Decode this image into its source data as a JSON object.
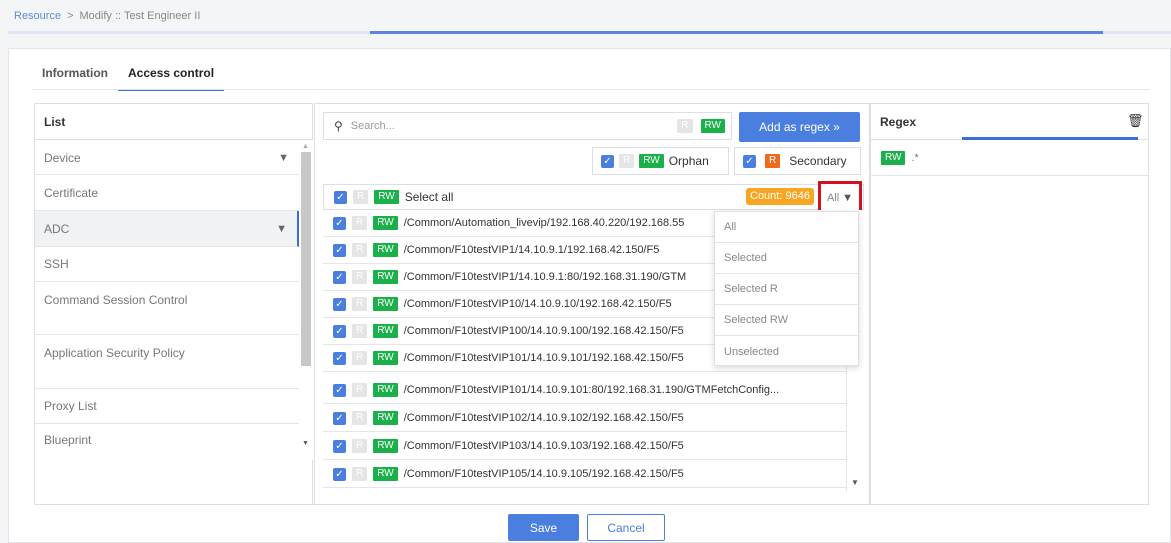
{
  "breadcrumb": {
    "root": "Resource",
    "sep": ">",
    "current": "Modify :: Test Engineer II"
  },
  "tabs": [
    {
      "label": "Information"
    },
    {
      "label": "Access control"
    }
  ],
  "list": {
    "header": "List",
    "items": [
      {
        "label": "Device"
      },
      {
        "label": "Certificate"
      },
      {
        "label": "ADC"
      },
      {
        "label": "SSH"
      },
      {
        "label": "Command Session Control"
      },
      {
        "label": "Application Security Policy"
      },
      {
        "label": "Proxy List"
      },
      {
        "label": "Blueprint"
      }
    ]
  },
  "search": {
    "placeholder": "Search...",
    "r": "R",
    "rw": "RW"
  },
  "add_regex": "Add as regex »",
  "toggles": {
    "orphan": "Orphan",
    "secondary": "Secondary",
    "r": "R",
    "rw": "RW"
  },
  "select_all": {
    "label": "Select all",
    "count": "Count: 9646",
    "filter": "All"
  },
  "rows": [
    "/Common/Automation_livevip/192.168.40.220/192.168.55",
    "/Common/F10testVIP1/14.10.9.1/192.168.42.150/F5",
    "/Common/F10testVIP1/14.10.9.1:80/192.168.31.190/GTM",
    "/Common/F10testVIP10/14.10.9.10/192.168.42.150/F5",
    "/Common/F10testVIP100/14.10.9.100/192.168.42.150/F5",
    "/Common/F10testVIP101/14.10.9.101/192.168.42.150/F5",
    "/Common/F10testVIP101/14.10.9.101:80/192.168.31.190/GTMFetchConfig...",
    "/Common/F10testVIP102/14.10.9.102/192.168.42.150/F5",
    "/Common/F10testVIP103/14.10.9.103/192.168.42.150/F5",
    "/Common/F10testVIP105/14.10.9.105/192.168.42.150/F5"
  ],
  "dropdown": [
    "All",
    "Selected",
    "Selected R",
    "Selected RW",
    "Unselected"
  ],
  "regex": {
    "header": "Regex",
    "badge": "RW",
    "value": ".*"
  },
  "footer": {
    "save": "Save",
    "cancel": "Cancel"
  },
  "colors": {
    "accent": "#4a7fe0",
    "rw": "#1ab04a",
    "r_active": "#f06a1e",
    "count": "#f6a623",
    "highlight": "#d6101c"
  }
}
